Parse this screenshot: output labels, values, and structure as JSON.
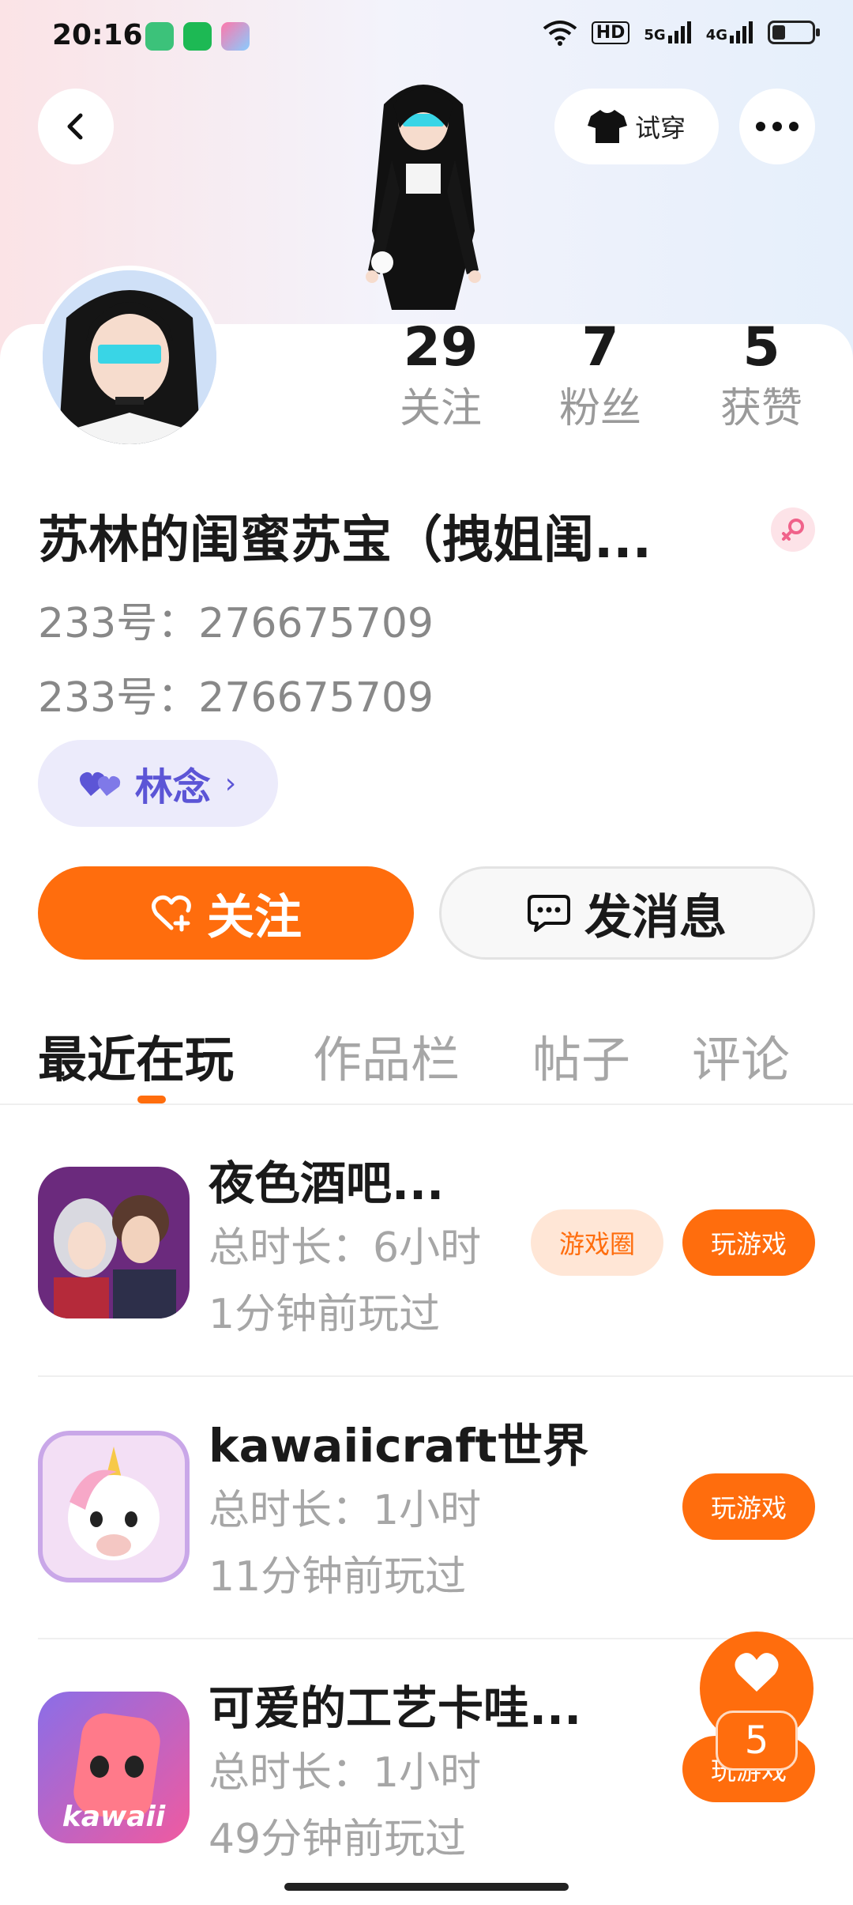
{
  "status_bar": {
    "time": "20:16",
    "signal_5g": "5G",
    "signal_4g": "4G",
    "hd": "HD",
    "battery_level": 0.3
  },
  "header": {
    "tryon_label": "试穿"
  },
  "profile": {
    "nickname": "苏林的闺蜜苏宝（拽姐闺...",
    "id_line_1": "233号：276675709",
    "id_line_2": "233号：276675709",
    "tag_label": "林念",
    "gender": "female"
  },
  "stats": [
    {
      "num": "29",
      "label": "关注"
    },
    {
      "num": "7",
      "label": "粉丝"
    },
    {
      "num": "5",
      "label": "获赞"
    }
  ],
  "actions": {
    "follow_label": "关注",
    "message_label": "发消息"
  },
  "tabs": [
    {
      "label": "最近在玩",
      "active": true
    },
    {
      "label": "作品栏",
      "active": false
    },
    {
      "label": "帖子",
      "active": false
    },
    {
      "label": "评论",
      "active": false
    }
  ],
  "games": [
    {
      "name": "夜色酒吧...",
      "total_time": "总时长：6小时",
      "last_played": "1分钟前玩过",
      "circle_label": "游戏圈",
      "play_label": "玩游戏"
    },
    {
      "name": "kawaiicraft世界",
      "total_time": "总时长：1小时",
      "last_played": "11分钟前玩过",
      "play_label": "玩游戏"
    },
    {
      "name": "可爱的工艺卡哇...",
      "total_time": "总时长：1小时",
      "last_played": "49分钟前玩过",
      "play_label": "玩游戏"
    }
  ],
  "fab": {
    "like_count": "5"
  },
  "colors": {
    "accent": "#ff6d0d",
    "tag_purple": "#5c55d6",
    "muted_text": "#9a9a9a"
  }
}
